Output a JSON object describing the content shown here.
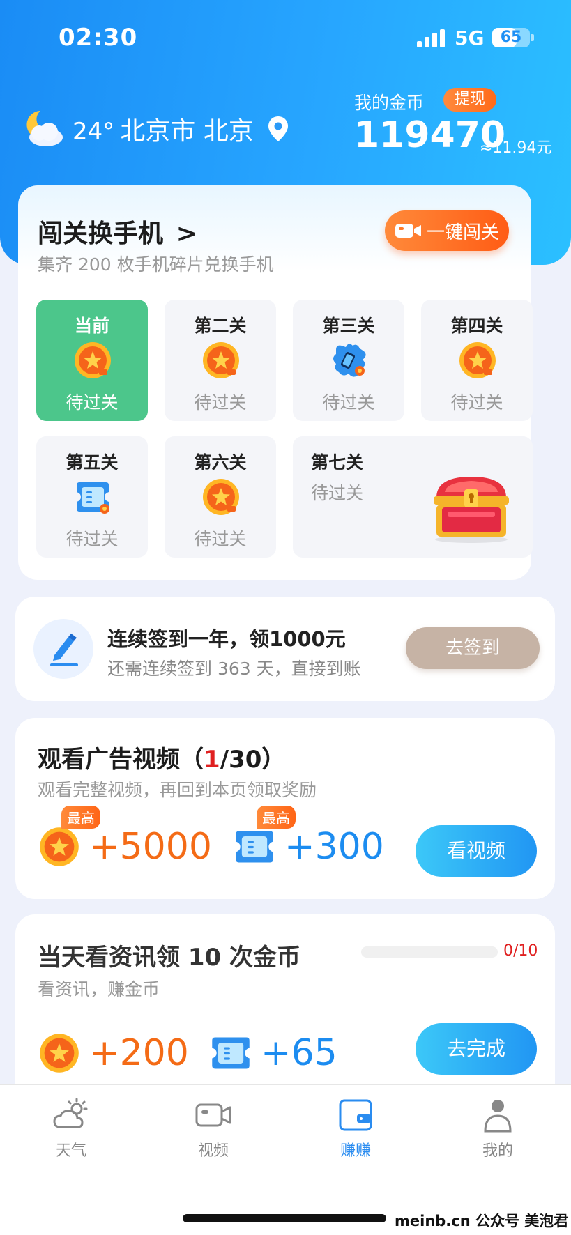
{
  "status_bar": {
    "time": "02:30",
    "network": "5G",
    "battery": "65",
    "battery_level": 0.65
  },
  "weather": {
    "temperature": "24°",
    "location": "北京市 北京"
  },
  "coins": {
    "label": "我的金币",
    "withdraw": "提现",
    "value": "119470",
    "cash": "≈11.94元"
  },
  "challenge": {
    "title": "闯关换手机",
    "subtitle": "集齐 200 枚手机碎片兑换手机",
    "button": "一键闯关",
    "levels": [
      {
        "name": "当前",
        "status": "待过关",
        "icon": "coin-icon"
      },
      {
        "name": "第二关",
        "status": "待过关",
        "icon": "coin-icon"
      },
      {
        "name": "第三关",
        "status": "待过关",
        "icon": "phone-fragment-icon"
      },
      {
        "name": "第四关",
        "status": "待过关",
        "icon": "coin-icon"
      },
      {
        "name": "第五关",
        "status": "待过关",
        "icon": "ticket-icon"
      },
      {
        "name": "第六关",
        "status": "待过关",
        "icon": "coin-icon"
      },
      {
        "name": "第七关",
        "status": "待过关",
        "icon": "treasure-chest-icon"
      }
    ]
  },
  "signin": {
    "title": "连续签到一年，领1000元",
    "subtitle": "还需连续签到 363 天，直接到账",
    "button": "去签到"
  },
  "ad_video": {
    "title_prefix": "观看广告视频（",
    "current": "1",
    "title_suffix": "/30）",
    "subtitle": "观看完整视频，再回到本页领取奖励",
    "badge": "最高",
    "coin_reward": "+5000",
    "ticket_reward": "+300",
    "button": "看视频"
  },
  "news": {
    "title": "当天看资讯领 10 次金币",
    "subtitle": "看资讯，赚金币",
    "progress_text": "0/10",
    "progress": 0,
    "coin_reward": "+200",
    "ticket_reward": "+65",
    "button": "去完成"
  },
  "tabbar": {
    "items": [
      {
        "label": "天气",
        "icon": "weather-icon"
      },
      {
        "label": "视频",
        "icon": "video-icon"
      },
      {
        "label": "赚赚",
        "icon": "wallet-icon",
        "active": true
      },
      {
        "label": "我的",
        "icon": "profile-icon"
      }
    ]
  },
  "watermark": "meinb.cn  公众号 美泡君",
  "colors": {
    "primary": "#1a8cf5",
    "accent": "#f46b16",
    "green": "#4cc68b",
    "signin_btn": "#c6b3a5"
  }
}
